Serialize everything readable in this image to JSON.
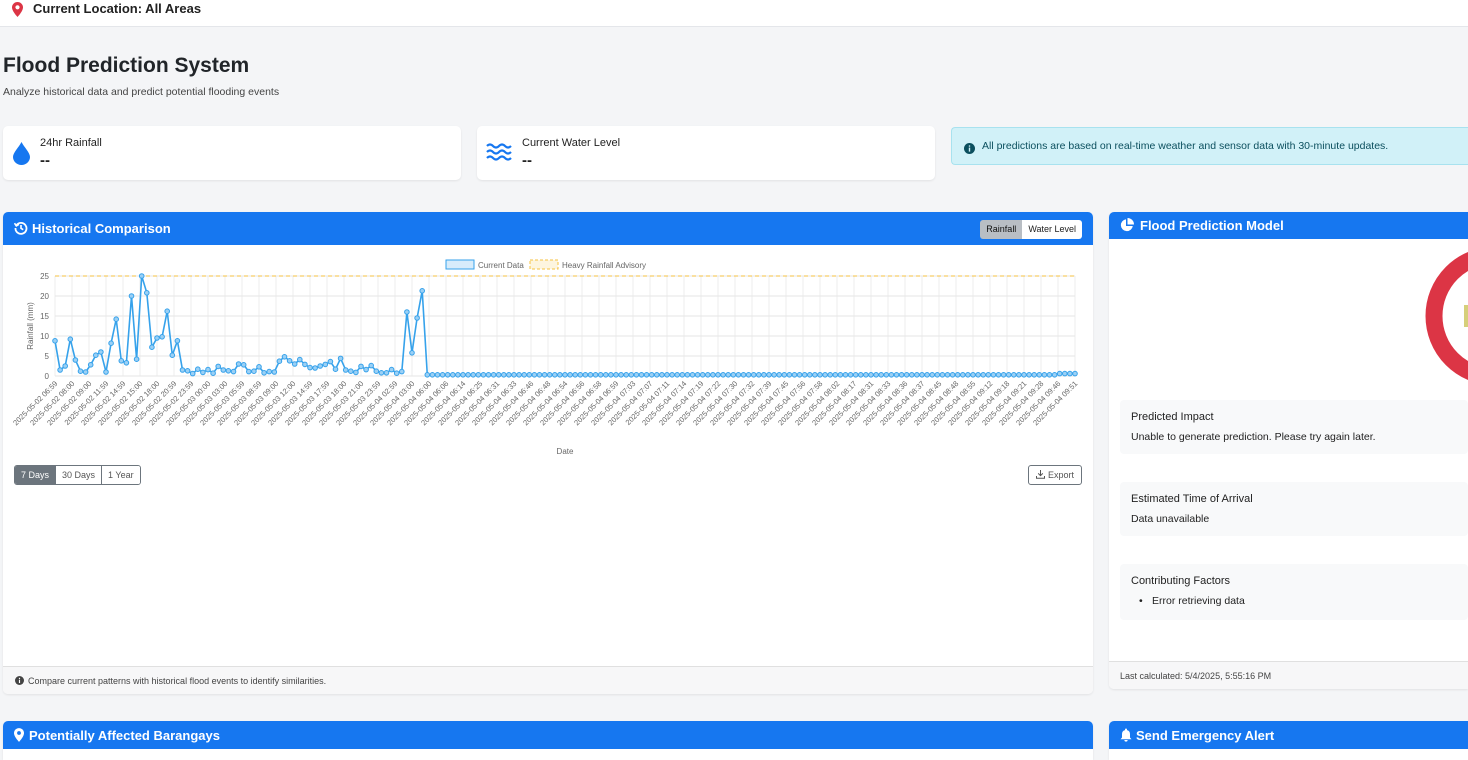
{
  "topbar": {
    "location_label": "Current Location: All Areas"
  },
  "page": {
    "title": "Flood Prediction System",
    "subtitle": "Analyze historical data and predict potential flooding events"
  },
  "stats": [
    {
      "label": "24hr Rainfall",
      "value": "--",
      "icon": "droplet-icon"
    },
    {
      "label": "Current Water Level",
      "value": "--",
      "icon": "water-waves-icon"
    }
  ],
  "info_alert": "All predictions are based on real-time weather and sensor data with 30-minute updates.",
  "historical": {
    "title": "Historical Comparison",
    "toggle": [
      "Rainfall",
      "Water Level"
    ],
    "toggle_active": "Rainfall",
    "ranges": [
      "7 Days",
      "30 Days",
      "1 Year"
    ],
    "range_active": "7 Days",
    "export_label": "Export",
    "footer": "Compare current patterns with historical flood events to identify similarities."
  },
  "prediction": {
    "title": "Flood Prediction Model",
    "impact_title": "Predicted Impact",
    "impact_value": "Unable to generate prediction. Please try again later.",
    "eta_title": "Estimated Time of Arrival",
    "eta_value": "Data unavailable",
    "factors_title": "Contributing Factors",
    "factors": [
      "Error retrieving data"
    ],
    "last_calculated": "Last calculated: 5/4/2025, 5:55:16 PM",
    "gauge_color": "#dc3545"
  },
  "sections": {
    "affected_title": "Potentially Affected Barangays",
    "alert_title": "Send Emergency Alert"
  },
  "colors": {
    "primary": "#1677f0",
    "series": "#36a2eb",
    "advisory": "#f5c242",
    "danger": "#dc3545"
  },
  "chart_data": {
    "type": "line",
    "xlabel": "Date",
    "ylabel": "Rainfall (mm)",
    "ylim": [
      0,
      25
    ],
    "yticks": [
      0,
      5,
      10,
      15,
      20,
      25
    ],
    "legend": [
      "Current Data",
      "Heavy Rainfall Advisory"
    ],
    "legend_position": "top",
    "grid": true,
    "advisory_threshold": 25,
    "x_tick_labels": [
      "2025-05-02 06:59",
      "2025-05-02 08:00",
      "2025-05-02 09:00",
      "2025-05-02 11:59",
      "2025-05-02 14:59",
      "2025-05-02 15:00",
      "2025-05-02 18:00",
      "2025-05-02 20:59",
      "2025-05-02 23:59",
      "2025-05-03 00:00",
      "2025-05-03 03:00",
      "2025-05-03 05:59",
      "2025-05-03 08:59",
      "2025-05-03 09:00",
      "2025-05-03 12:00",
      "2025-05-03 14:59",
      "2025-05-03 17:59",
      "2025-05-03 18:00",
      "2025-05-03 21:00",
      "2025-05-03 23:59",
      "2025-05-04 02:59",
      "2025-05-04 03:00",
      "2025-05-04 06:00",
      "2025-05-04 06:06",
      "2025-05-04 06:14",
      "2025-05-04 06:25",
      "2025-05-04 06:31",
      "2025-05-04 06:33",
      "2025-05-04 06:46",
      "2025-05-04 06:48",
      "2025-05-04 06:54",
      "2025-05-04 06:56",
      "2025-05-04 06:58",
      "2025-05-04 06:59",
      "2025-05-04 07:03",
      "2025-05-04 07:07",
      "2025-05-04 07:11",
      "2025-05-04 07:14",
      "2025-05-04 07:19",
      "2025-05-04 07:22",
      "2025-05-04 07:30",
      "2025-05-04 07:32",
      "2025-05-04 07:39",
      "2025-05-04 07:45",
      "2025-05-04 07:56",
      "2025-05-04 07:58",
      "2025-05-04 08:02",
      "2025-05-04 08:17",
      "2025-05-04 08:31",
      "2025-05-04 08:33",
      "2025-05-04 08:36",
      "2025-05-04 08:37",
      "2025-05-04 08:45",
      "2025-05-04 08:48",
      "2025-05-04 08:55",
      "2025-05-04 09:12",
      "2025-05-04 09:18",
      "2025-05-04 09:21",
      "2025-05-04 09:28",
      "2025-05-04 09:46",
      "2025-05-04 09:51"
    ],
    "series": [
      {
        "name": "Current Data",
        "values": [
          8.8,
          1.5,
          2.5,
          9.2,
          4,
          1.2,
          1,
          2.8,
          5.2,
          6,
          1,
          8.2,
          14.2,
          3.8,
          3.3,
          20,
          4.2,
          25,
          20.8,
          7.2,
          9.5,
          9.8,
          16.2,
          5.2,
          8.8,
          1.5,
          1.3,
          0.6,
          1.7,
          0.9,
          1.6,
          0.7,
          2.4,
          1.5,
          1.3,
          1.1,
          3,
          2.8,
          1.1,
          1.2,
          2.3,
          0.8,
          1.1,
          1,
          3.7,
          4.8,
          3.8,
          3,
          4.1,
          2.9,
          2.1,
          2,
          2.5,
          2.9,
          3.6,
          1.7,
          4.4,
          1.5,
          1.2,
          0.9,
          2.4,
          1.6,
          2.6,
          1.2,
          0.8,
          0.8,
          1.6,
          0.7,
          1.1,
          16,
          5.8,
          14.5,
          21.3,
          0.3,
          0.3,
          0.3,
          0.3,
          0.3,
          0.3,
          0.3,
          0.3,
          0.3,
          0.3,
          0.3,
          0.3,
          0.3,
          0.3,
          0.3,
          0.3,
          0.3,
          0.3,
          0.3,
          0.3,
          0.3,
          0.3,
          0.3,
          0.3,
          0.3,
          0.3,
          0.3,
          0.3,
          0.3,
          0.3,
          0.3,
          0.3,
          0.3,
          0.3,
          0.3,
          0.3,
          0.3,
          0.3,
          0.3,
          0.3,
          0.3,
          0.3,
          0.3,
          0.3,
          0.3,
          0.3,
          0.3,
          0.3,
          0.3,
          0.3,
          0.3,
          0.3,
          0.3,
          0.3,
          0.3,
          0.3,
          0.3,
          0.3,
          0.3,
          0.3,
          0.3,
          0.3,
          0.3,
          0.3,
          0.3,
          0.3,
          0.3,
          0.3,
          0.3,
          0.3,
          0.3,
          0.3,
          0.3,
          0.3,
          0.3,
          0.3,
          0.3,
          0.3,
          0.3,
          0.3,
          0.3,
          0.3,
          0.3,
          0.3,
          0.3,
          0.3,
          0.3,
          0.3,
          0.3,
          0.3,
          0.3,
          0.3,
          0.3,
          0.3,
          0.3,
          0.3,
          0.3,
          0.3,
          0.3,
          0.3,
          0.3,
          0.3,
          0.3,
          0.3,
          0.3,
          0.3,
          0.3,
          0.3,
          0.3,
          0.3,
          0.3,
          0.3,
          0.3,
          0.3,
          0.3,
          0.3,
          0.3,
          0.3,
          0.3,
          0.3,
          0.3,
          0.3,
          0.3,
          0.3,
          0.6,
          0.6,
          0.6,
          0.6
        ]
      }
    ]
  }
}
